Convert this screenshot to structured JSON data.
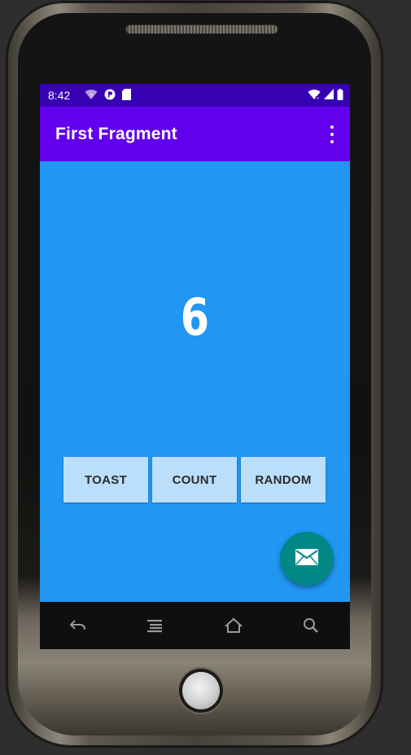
{
  "status_bar": {
    "time": "8:42",
    "left_icons": [
      "wifi-question-icon",
      "app-p-icon",
      "sd-card-icon"
    ],
    "right_icons": [
      "wifi-icon",
      "signal-icon",
      "battery-icon"
    ]
  },
  "app_bar": {
    "title": "First Fragment",
    "menu_icon": "more-vert-icon"
  },
  "main": {
    "count": "6"
  },
  "buttons": {
    "toast": "TOAST",
    "count": "COUNT",
    "random": "RANDOM"
  },
  "fab": {
    "icon": "email-icon"
  },
  "nav_bar": {
    "keys": [
      "back-icon",
      "menu-icon",
      "home-icon",
      "search-icon"
    ]
  },
  "colors": {
    "status_bar": "#3700b3",
    "app_bar": "#6200ee",
    "background": "#2196f3",
    "button": "#bbdefb",
    "fab": "#018786"
  }
}
